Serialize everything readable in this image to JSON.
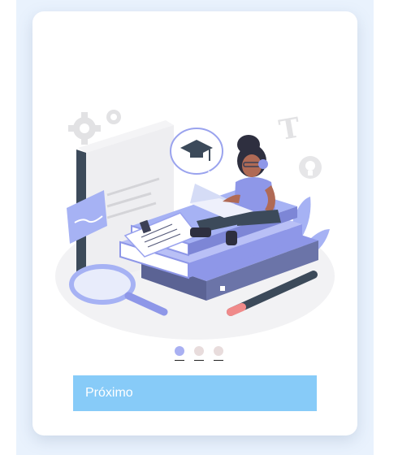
{
  "onboarding": {
    "illustration_icon": "student-studying-illustration",
    "dots": [
      {
        "state": "active",
        "color": "#a9b0f2"
      },
      {
        "state": "inactive",
        "color": "#e8dcdc"
      },
      {
        "state": "inactive",
        "color": "#e8dcdc"
      }
    ],
    "next_label": "Próximo"
  },
  "colors": {
    "background_panel": "#e9f2fd",
    "card": "#ffffff",
    "button": "#87cbf8",
    "accent_purple": "#8e97e8",
    "book_dark": "#5b6394"
  }
}
